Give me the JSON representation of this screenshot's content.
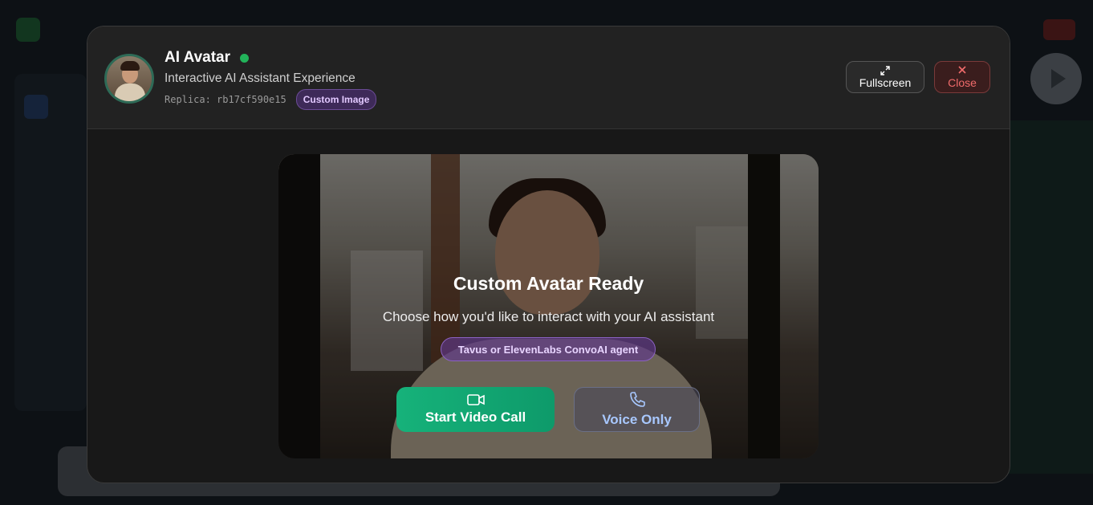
{
  "header": {
    "title": "AI Avatar",
    "subtitle": "Interactive AI Assistant Experience",
    "replica": "Replica: rb17cf590e15",
    "badge": "Custom Image",
    "status_color": "#22b35a"
  },
  "actions": {
    "fullscreen_label": "Fullscreen",
    "fullscreen_icon": "expand-icon",
    "close_label": "Close",
    "close_icon": "close-icon"
  },
  "video_panel": {
    "title": "Custom Avatar Ready",
    "subtitle": "Choose how you'd like to interact with your AI assistant",
    "agent_badge": "Tavus or ElevenLabs ConvoAI agent",
    "start_video_label": "Start Video Call",
    "start_video_icon": "video-camera-icon",
    "voice_only_label": "Voice Only",
    "voice_only_icon": "phone-icon"
  },
  "colors": {
    "accent_green": "#16b27a",
    "danger": "#f06b6b",
    "purple_badge": "#3e2a59",
    "voice_text": "#a8c8ff"
  }
}
